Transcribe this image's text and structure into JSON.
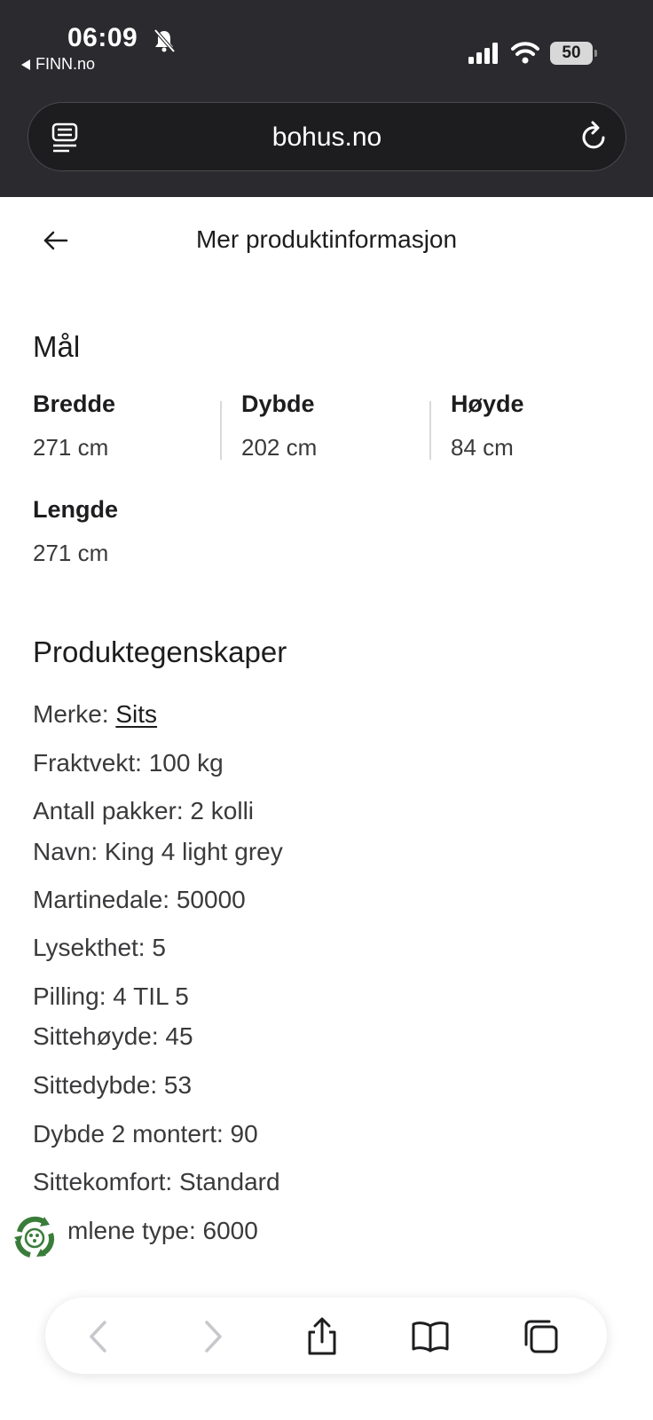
{
  "status_bar": {
    "time": "06:09",
    "back_app_label": "FINN.no",
    "battery_level": "50",
    "icons": [
      "bell-slash-icon",
      "signal-icon",
      "wifi-icon",
      "battery-icon"
    ]
  },
  "browser": {
    "url": "bohus.no",
    "icons": [
      "reader-icon",
      "reload-icon"
    ]
  },
  "header": {
    "title": "Mer produktinformasjon"
  },
  "dimensions": {
    "title": "Mål",
    "items": [
      {
        "label": "Bredde",
        "value": "271 cm"
      },
      {
        "label": "Dybde",
        "value": "202 cm"
      },
      {
        "label": "Høyde",
        "value": "84 cm"
      },
      {
        "label": "Lengde",
        "value": "271 cm"
      }
    ]
  },
  "properties": {
    "title": "Produktegenskaper",
    "brand": {
      "label": "Merke:",
      "value": "Sits"
    },
    "items": [
      "Fraktvekt: 100 kg",
      "Antall pakker: 2 kolli",
      "Navn: King 4 light grey",
      "Martinedale: 50000",
      "Lysekthet: 5",
      "Pilling: 4 TIL 5",
      "Sittehøyde: 45",
      "Sittedybde: 53",
      "Dybde 2 montert: 90",
      "Sittekomfort: Standard",
      "mlene type: 6000"
    ]
  },
  "toolbar": {
    "icons": [
      "back-icon",
      "forward-icon",
      "share-icon",
      "bookmarks-icon",
      "tabs-icon"
    ]
  },
  "colors": {
    "chrome_bg": "#2b2b2f",
    "text": "#1d1d1f",
    "fab_green": "#3a7d3a"
  }
}
